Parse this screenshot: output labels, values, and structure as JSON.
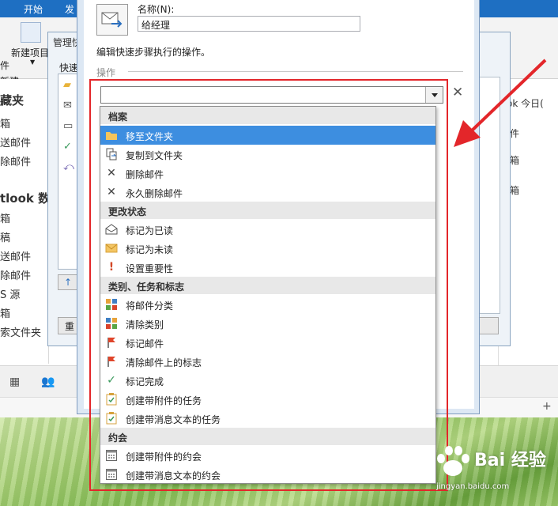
{
  "ribbon": {
    "tab_start": "开始",
    "tab_send": "发",
    "new_item": "新建项目",
    "items_label": "件",
    "new_group": "新建"
  },
  "folder_pane": {
    "favorites_head": "藏夹",
    "items_a": [
      "箱",
      "送邮件",
      "除邮件"
    ],
    "outlook_head": "tlook 数",
    "items_b": [
      "箱",
      "稿",
      "送邮件",
      "除邮件",
      "S 源",
      "箱",
      "索文件夹"
    ]
  },
  "right_pane": {
    "today": "ok 今日(",
    "col": "件",
    "row1": "箱",
    "row2": "箱"
  },
  "manage_dialog": {
    "title": "管理快",
    "list_header": "快速",
    "left_button": "重",
    "cancel_button": "消",
    "side_label": "说",
    "up_arrow": "↑"
  },
  "edit_dialog": {
    "name_label": "名称(N):",
    "name_value": "给经理",
    "hint": "编辑快速步骤执行的操作。",
    "section_label": "操作",
    "delete_glyph": "✕"
  },
  "dropdown": {
    "groups": {
      "archive": "档案",
      "status": "更改状态",
      "category": "类别、任务和标志",
      "appointment": "约会"
    },
    "options": {
      "move": "移至文件夹",
      "copy": "复制到文件夹",
      "delete": "删除邮件",
      "perm_delete": "永久删除邮件",
      "mark_read": "标记为已读",
      "mark_unread": "标记为未读",
      "importance": "设置重要性",
      "categorize": "将邮件分类",
      "clear_cat": "清除类别",
      "flag": "标记邮件",
      "clear_flag": "清除邮件上的标志",
      "complete": "标记完成",
      "task_attach": "创建带附件的任务",
      "task_text": "创建带消息文本的任务",
      "appt_attach": "创建带附件的约会",
      "appt_text": "创建带消息文本的约会"
    },
    "selected": "move"
  },
  "statusbar": {
    "plus": "+"
  },
  "watermark": {
    "brand": "Bai 经验",
    "url": "jingyan.baidu.com"
  },
  "colors": {
    "selection": "#3d8ee0",
    "annotation": "#e3262a",
    "ribbon": "#1e6fc2"
  }
}
